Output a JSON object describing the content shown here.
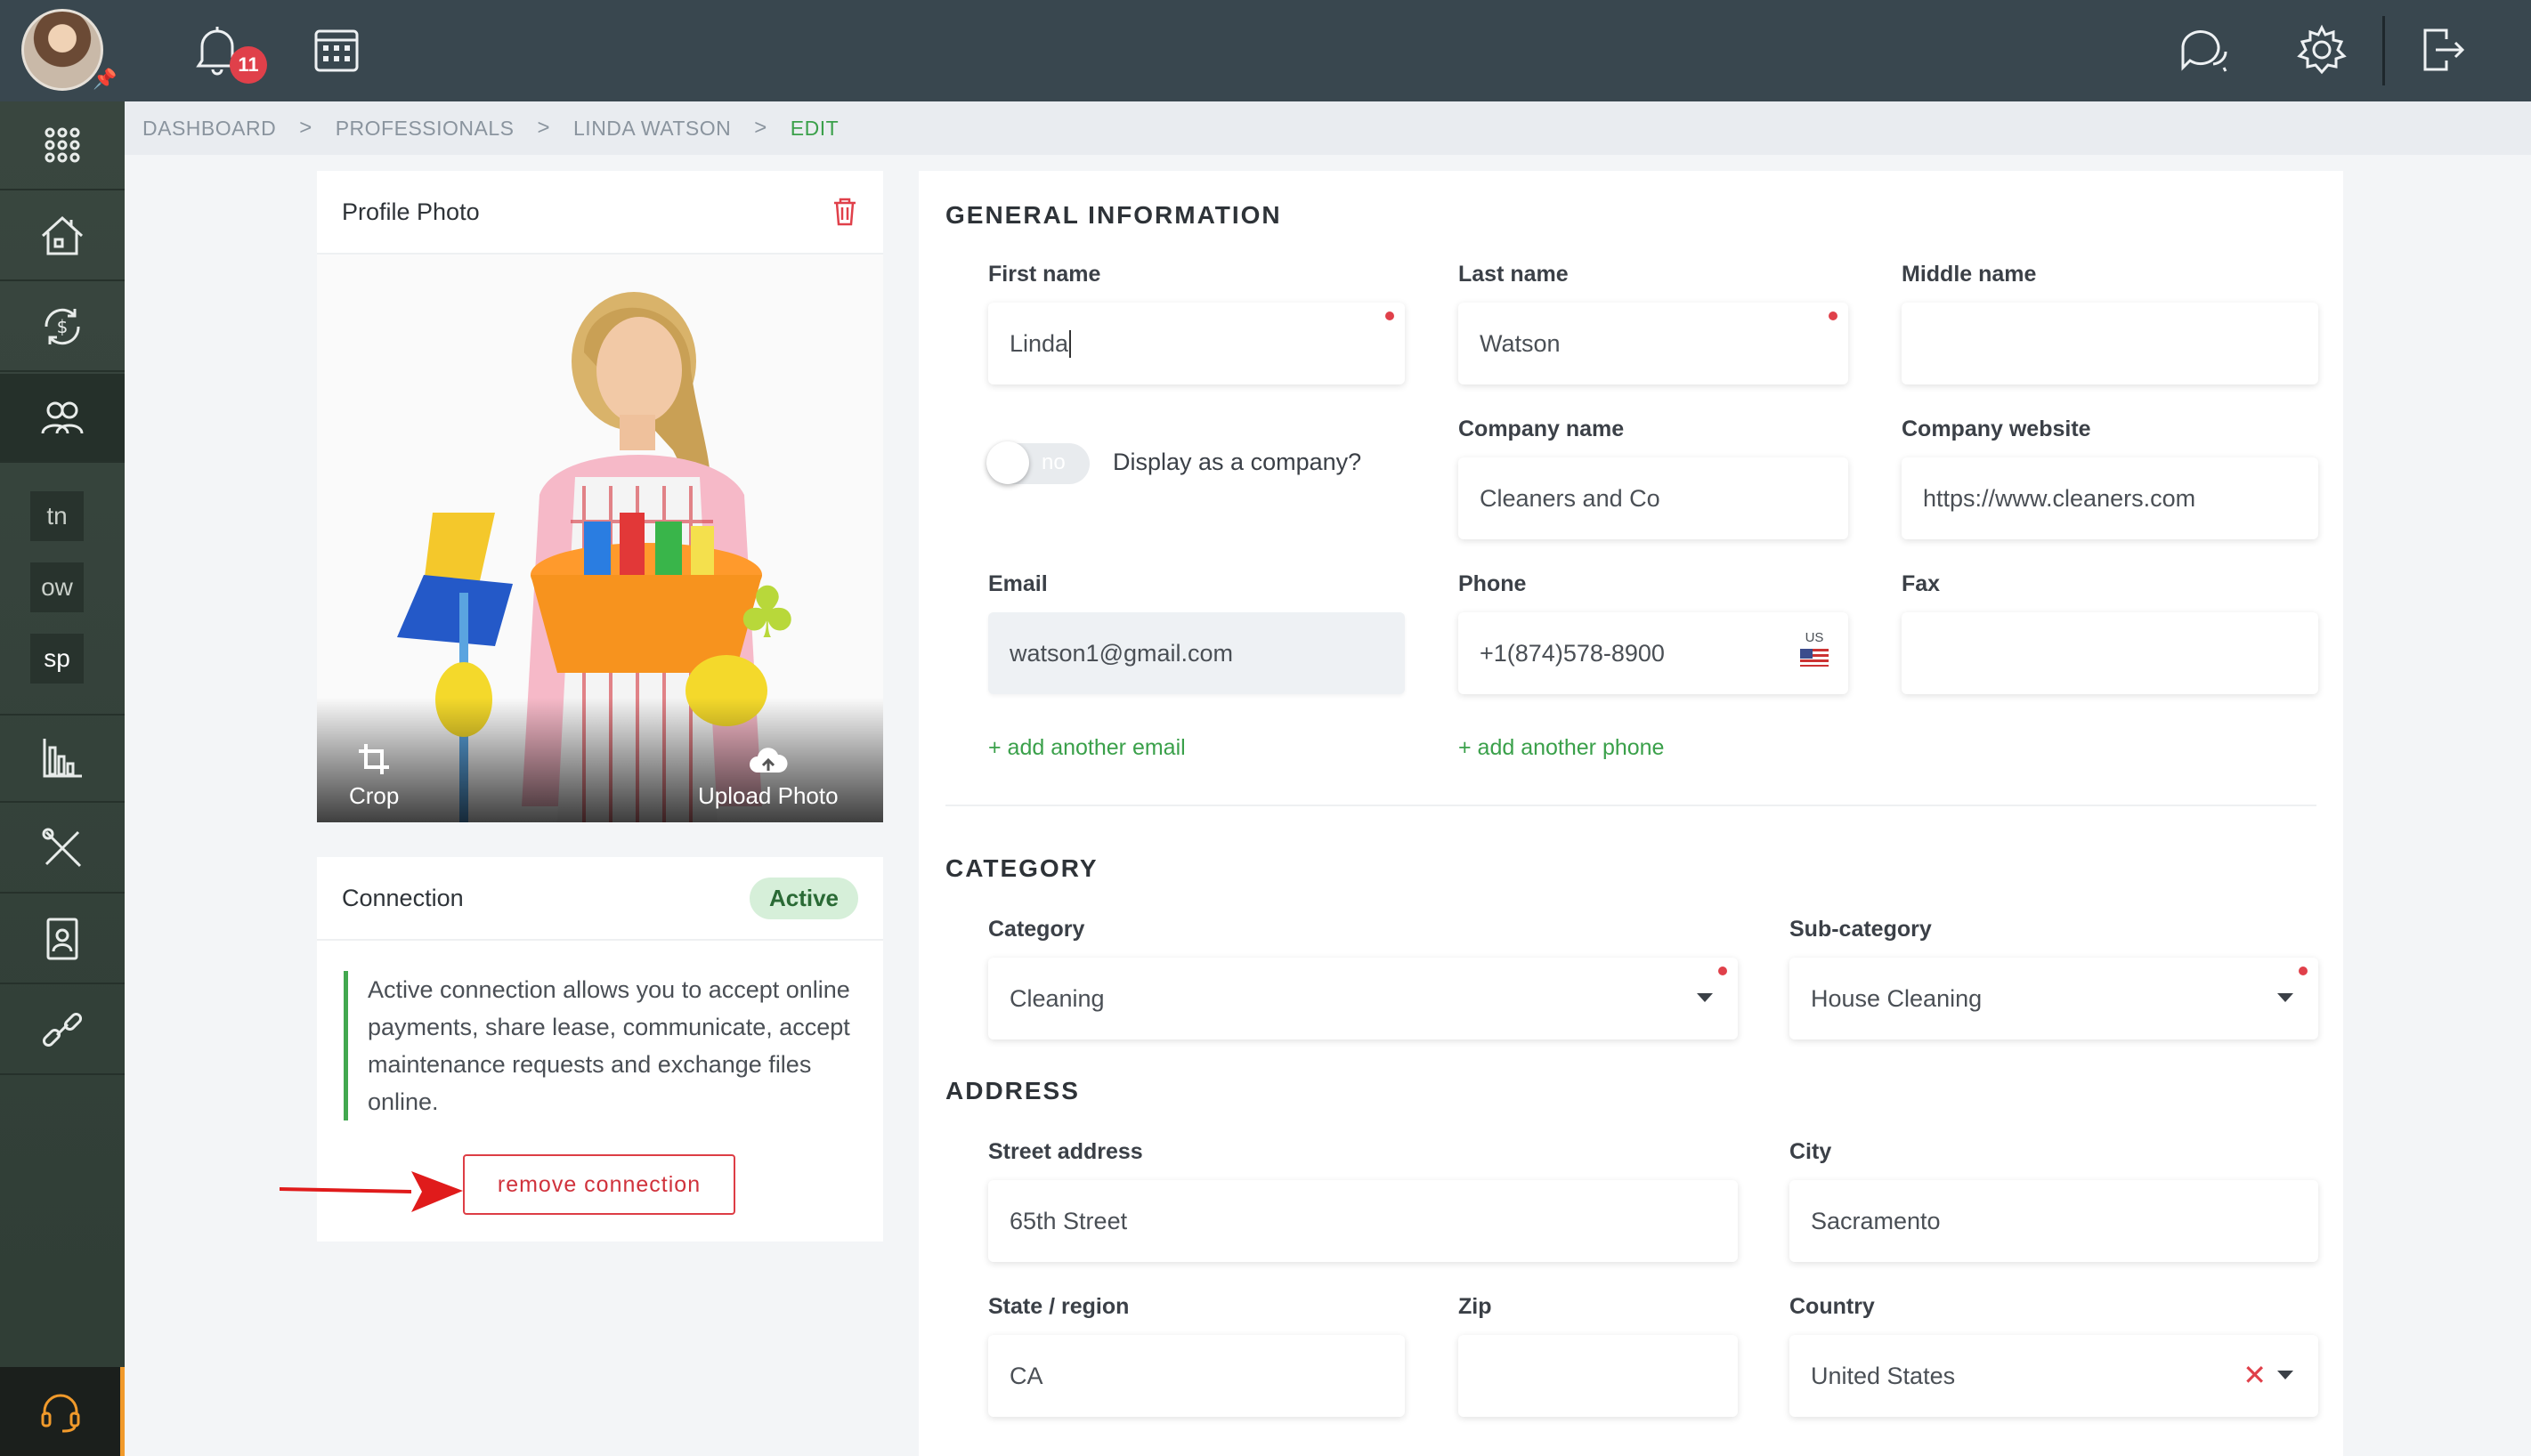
{
  "topbar": {
    "notification_count": "11"
  },
  "breadcrumb": {
    "items": [
      "DASHBOARD",
      "PROFESSIONALS",
      "LINDA WATSON"
    ],
    "current": "EDIT",
    "separator": ">"
  },
  "sidebar": {
    "tags": [
      "tn",
      "ow",
      "sp"
    ]
  },
  "photo_card": {
    "title": "Profile Photo",
    "crop_label": "Crop",
    "upload_label": "Upload Photo"
  },
  "connection": {
    "title": "Connection",
    "status": "Active",
    "description": "Active connection allows you to accept online payments, share lease, communicate, accept maintenance requests and exchange files online.",
    "remove_label": "remove connection"
  },
  "general": {
    "title": "GENERAL INFORMATION",
    "first_name_label": "First name",
    "first_name_value": "Linda",
    "last_name_label": "Last name",
    "last_name_value": "Watson",
    "middle_name_label": "Middle name",
    "middle_name_value": "",
    "toggle_text": "no",
    "display_company_label": "Display as a company?",
    "company_name_label": "Company name",
    "company_name_value": "Cleaners and Co",
    "company_website_label": "Company website",
    "company_website_value": "https://www.cleaners.com",
    "email_label": "Email",
    "email_value": "watson1@gmail.com",
    "phone_label": "Phone",
    "phone_value": "+1(874)578-8900",
    "phone_country": "US",
    "fax_label": "Fax",
    "fax_value": "",
    "add_email": "+ add another email",
    "add_phone": "+ add another phone"
  },
  "category": {
    "title": "CATEGORY",
    "category_label": "Category",
    "category_value": "Cleaning",
    "subcategory_label": "Sub-category",
    "subcategory_value": "House Cleaning"
  },
  "address": {
    "title": "ADDRESS",
    "street_label": "Street address",
    "street_value": "65th Street",
    "city_label": "City",
    "city_value": "Sacramento",
    "state_label": "State / region",
    "state_value": "CA",
    "zip_label": "Zip",
    "zip_value": "",
    "country_label": "Country",
    "country_value": "United States",
    "clear_symbol": "✕"
  },
  "colors": {
    "accent_green": "#3aa04a",
    "danger_red": "#dd3d45",
    "topbar": "#39474f",
    "sidebar": "#2f3d35",
    "help_accent": "#f19a2b"
  }
}
